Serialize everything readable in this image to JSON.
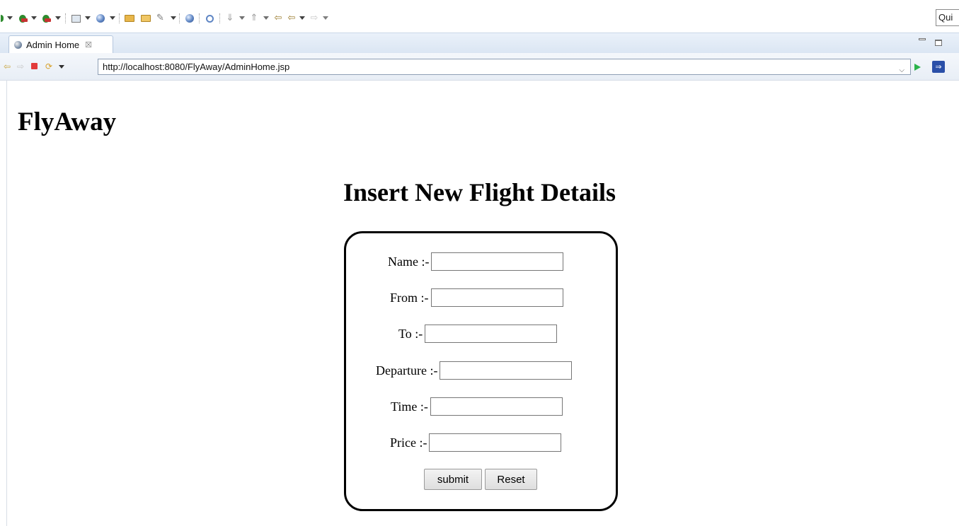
{
  "toolbar": {
    "quick_access_text": "Qui"
  },
  "editor_tab": {
    "label": "Admin Home",
    "close_glyph": "☒"
  },
  "browser": {
    "url": "http://localhost:8080/FlyAway/AdminHome.jsp",
    "back_glyph": "⇦",
    "forward_glyph": "⇨",
    "refresh_glyph": "⟳",
    "open_external_glyph": "⇒"
  },
  "page": {
    "site_title": "FlyAway",
    "form_heading": "Insert New Flight Details",
    "form": {
      "fields": [
        {
          "label": "Name :-",
          "value": ""
        },
        {
          "label": "From :-",
          "value": ""
        },
        {
          "label": "To :-",
          "value": ""
        },
        {
          "label": "Departure :-",
          "value": ""
        },
        {
          "label": "Time :-",
          "value": ""
        },
        {
          "label": "Price :-",
          "value": ""
        }
      ],
      "submit_label": "submit",
      "reset_label": "Reset"
    }
  },
  "colors": {
    "run_button_green": "#2bb34a",
    "stop_red": "#e23b3b",
    "tab_bar_blue": "#dbe6f3"
  },
  "icons": {
    "toolbar": [
      "run-icon",
      "debug-icon",
      "external-tools-icon",
      "new-server-icon",
      "web-service-icon",
      "open-folder-icon",
      "open-file-icon",
      "pencil-icon",
      "globe-icon",
      "search-icon",
      "next-annotation-icon",
      "prev-annotation-icon",
      "last-edit-icon",
      "back-icon",
      "forward-icon"
    ],
    "tab": "globe-icon",
    "navbar": [
      "back-icon",
      "forward-icon",
      "stop-icon",
      "refresh-icon",
      "go-icon",
      "open-external-browser-icon"
    ]
  }
}
